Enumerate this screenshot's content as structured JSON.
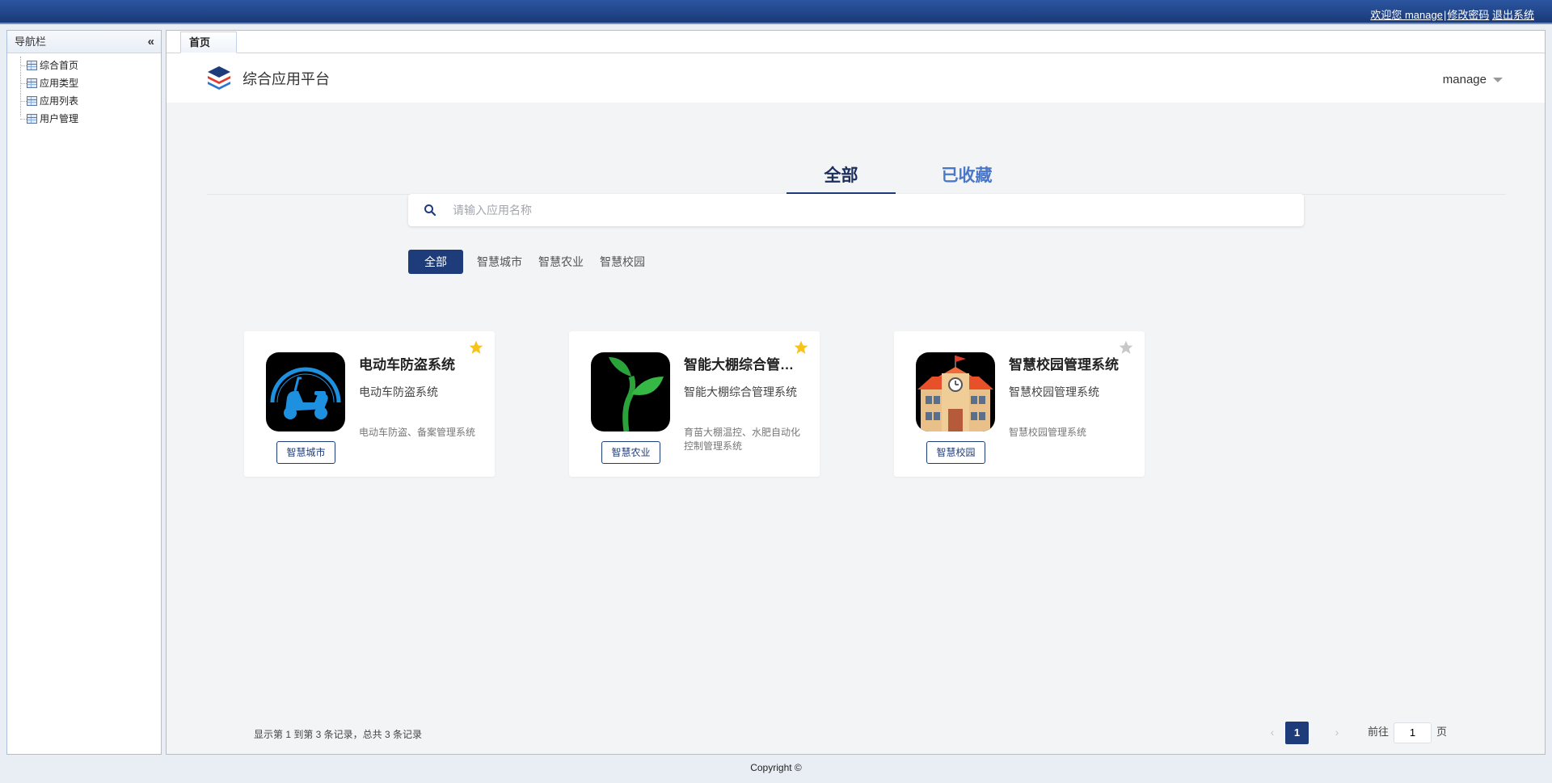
{
  "topbar": {
    "welcome": "欢迎您 manage",
    "change_password": "修改密码",
    "logout": "退出系统"
  },
  "sidebar": {
    "title": "导航栏",
    "items": [
      {
        "label": "综合首页"
      },
      {
        "label": "应用类型"
      },
      {
        "label": "应用列表"
      },
      {
        "label": "用户管理"
      }
    ]
  },
  "tabstrip": {
    "home": "首页"
  },
  "header": {
    "app_title": "综合应用平台",
    "user": "manage"
  },
  "main_tabs": {
    "all": "全部",
    "favorites": "已收藏"
  },
  "search": {
    "placeholder": "请输入应用名称"
  },
  "filters": [
    "全部",
    "智慧城市",
    "智慧农业",
    "智慧校园"
  ],
  "cards": [
    {
      "name": "电动车防盗系统",
      "subtitle": "电动车防盗系统",
      "description": "电动车防盗、备案管理系统",
      "tag": "智慧城市",
      "starred": true
    },
    {
      "name": "智能大棚综合管理系统",
      "subtitle": "智能大棚综合管理系统",
      "description": "育苗大棚温控、水肥自动化控制管理系统",
      "tag": "智慧农业",
      "starred": true
    },
    {
      "name": "智慧校园管理系统",
      "subtitle": "智慧校园管理系统",
      "description": "智慧校园管理系统",
      "tag": "智慧校园",
      "starred": false
    }
  ],
  "pagination": {
    "summary": "显示第 1 到第 3 条记录，总共 3 条记录",
    "current_page": "1",
    "goto_prefix": "前往",
    "goto_suffix": "页",
    "goto_value": "1"
  },
  "footer": {
    "copyright": "Copyright ©"
  },
  "colors": {
    "primary": "#1e3c7a",
    "star_active": "#f7c31a",
    "star_inactive": "#c8c8c8"
  }
}
